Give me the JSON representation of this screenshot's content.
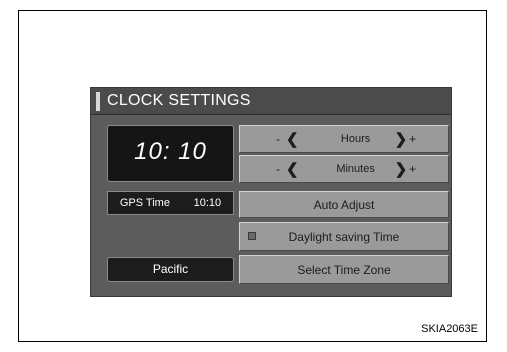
{
  "title": "CLOCK SETTINGS",
  "clock": {
    "time": "10: 10"
  },
  "gps": {
    "label": "GPS Time",
    "time": "10:10"
  },
  "timezone": {
    "value": "Pacific"
  },
  "hours": {
    "minus": "-",
    "chevron_left": "❮",
    "label": "Hours",
    "chevron_right": "❯",
    "plus": "+"
  },
  "minutes": {
    "minus": "-",
    "chevron_left": "❮",
    "label": "Minutes",
    "chevron_right": "❯",
    "plus": "+"
  },
  "buttons": {
    "auto_adjust": "Auto Adjust",
    "daylight_saving": "Daylight saving Time",
    "select_time_zone": "Select Time Zone"
  },
  "daylight_indicator": {
    "state": "off",
    "color": "#6a6a6a"
  },
  "caption": "SKIA2063E"
}
